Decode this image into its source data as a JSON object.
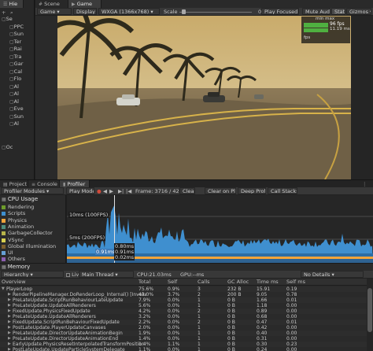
{
  "hierarchy": {
    "tab_label": "Hie",
    "items": [
      "Se",
      "PPC",
      "Sun",
      "Ter",
      "Rai",
      "Tra",
      "Gar",
      "Cal",
      "Flo",
      "Al",
      "Al",
      "Al",
      "Eve",
      "Sun",
      "Al",
      "Oc"
    ]
  },
  "scene_tabs": {
    "scene": "Scene",
    "game": "Game"
  },
  "game_toolbar": {
    "game_dropdown": "Game",
    "display": "Display 1",
    "resolution": "WXGA (1366x768)",
    "scale_label": "Scale",
    "scale_value": "0.58x",
    "play_focused": "Play Focused",
    "mute_audio": "Mute Audio",
    "stats": "Stats",
    "gizmos": "Gizmos"
  },
  "fps_overlay": {
    "header": "min  max",
    "fps": "96 fps",
    "ms": "11.19 ms",
    "fps_label": "fps"
  },
  "bottom_tabs": {
    "project": "Project",
    "console": "Console",
    "profiler": "Profiler"
  },
  "profiler_toolbar": {
    "modules": "Profiler Modules",
    "play_mode": "Play Mode",
    "frame": "Frame: 3716 / 4222",
    "clear": "Clear",
    "clear_on_play": "Clear on Play",
    "deep_profile": "Deep Profile",
    "call_stacks": "Call Stacks"
  },
  "cpu_module": {
    "title": "CPU Usage",
    "legend": [
      {
        "label": "Rendering",
        "color": "#6e9c2b"
      },
      {
        "label": "Scripts",
        "color": "#3f8fcf"
      },
      {
        "label": "Physics",
        "color": "#f2a43a"
      },
      {
        "label": "Animation",
        "color": "#4f8d7d"
      },
      {
        "label": "GarbageCollector",
        "color": "#b7b44a"
      },
      {
        "label": "VSync",
        "color": "#d8d050"
      },
      {
        "label": "Global Illumination",
        "color": "#7d5f2e"
      },
      {
        "label": "UI",
        "color": "#67a0d5"
      },
      {
        "label": "Others",
        "color": "#8c5fb0"
      }
    ],
    "label_10ms": "10ms (100FPS)",
    "label_5ms": "5ms (200FPS)",
    "label_091a": "0.91ms",
    "label_091b": "0.91ms",
    "label_080": "0.80ms",
    "label_002": "0.02ms"
  },
  "memory_module": {
    "title": "Memory"
  },
  "detail_toolbar": {
    "view": "Hierarchy",
    "live": "Live",
    "thread": "Main Thread",
    "cpu": "CPU:21.03ms",
    "gpu": "GPU:--ms",
    "details": "No Details"
  },
  "table": {
    "headers": [
      "Overview",
      "Total",
      "Self",
      "Calls",
      "GC Alloc",
      "Time ms",
      "Self ms"
    ],
    "rows": [
      {
        "name": "PlayerLoop",
        "total": "75.6%",
        "self": "0.9%",
        "calls": "3",
        "gc": "232 B",
        "time": "15.91",
        "selfms": "0.19"
      },
      {
        "name": "RenderPipelineManager.DoRenderLoop_Internal() [Invoke]",
        "total": "43.0%",
        "self": "3.7%",
        "calls": "2",
        "gc": "200 B",
        "time": "9.05",
        "selfms": "0.78"
      },
      {
        "name": "PreLateUpdate.ScriptRunBehaviourLateUpdate",
        "total": "7.9%",
        "self": "0.0%",
        "calls": "1",
        "gc": "0 B",
        "time": "1.66",
        "selfms": "0.01"
      },
      {
        "name": "PreLateUpdate.UpdateAllRenderers",
        "total": "5.6%",
        "self": "0.0%",
        "calls": "1",
        "gc": "0 B",
        "time": "1.18",
        "selfms": "0.00"
      },
      {
        "name": "FixedUpdate.PhysicsFixedUpdate",
        "total": "4.2%",
        "self": "0.0%",
        "calls": "2",
        "gc": "0 B",
        "time": "0.89",
        "selfms": "0.00"
      },
      {
        "name": "PreLateUpdate.UpdateAllRenderers",
        "total": "3.2%",
        "self": "0.0%",
        "calls": "1",
        "gc": "0 B",
        "time": "0.68",
        "selfms": "0.00"
      },
      {
        "name": "FixedUpdate.ScriptRunBehaviourFixedUpdate",
        "total": "2.2%",
        "self": "0.0%",
        "calls": "2",
        "gc": "0 B",
        "time": "0.47",
        "selfms": "0.01"
      },
      {
        "name": "PostLateUpdate.PlayerUpdateCanvases",
        "total": "2.0%",
        "self": "0.0%",
        "calls": "1",
        "gc": "0 B",
        "time": "0.42",
        "selfms": "0.00"
      },
      {
        "name": "PreLateUpdate.DirectorUpdateAnimationBegin",
        "total": "1.9%",
        "self": "0.0%",
        "calls": "1",
        "gc": "0 B",
        "time": "0.40",
        "selfms": "0.00"
      },
      {
        "name": "PreLateUpdate.DirectorUpdateAnimationEnd",
        "total": "1.4%",
        "self": "0.0%",
        "calls": "1",
        "gc": "0 B",
        "time": "0.31",
        "selfms": "0.00"
      },
      {
        "name": "EarlyUpdate.PhysicsResetInterpolatedTransformPosition",
        "total": "1.4%",
        "self": "1.1%",
        "calls": "1",
        "gc": "0 B",
        "time": "0.30",
        "selfms": "0.23"
      },
      {
        "name": "PostLateUpdate.UpdateParticleSystemDelegate",
        "total": "1.1%",
        "self": "0.0%",
        "calls": "1",
        "gc": "0 B",
        "time": "0.24",
        "selfms": "0.00"
      }
    ]
  }
}
